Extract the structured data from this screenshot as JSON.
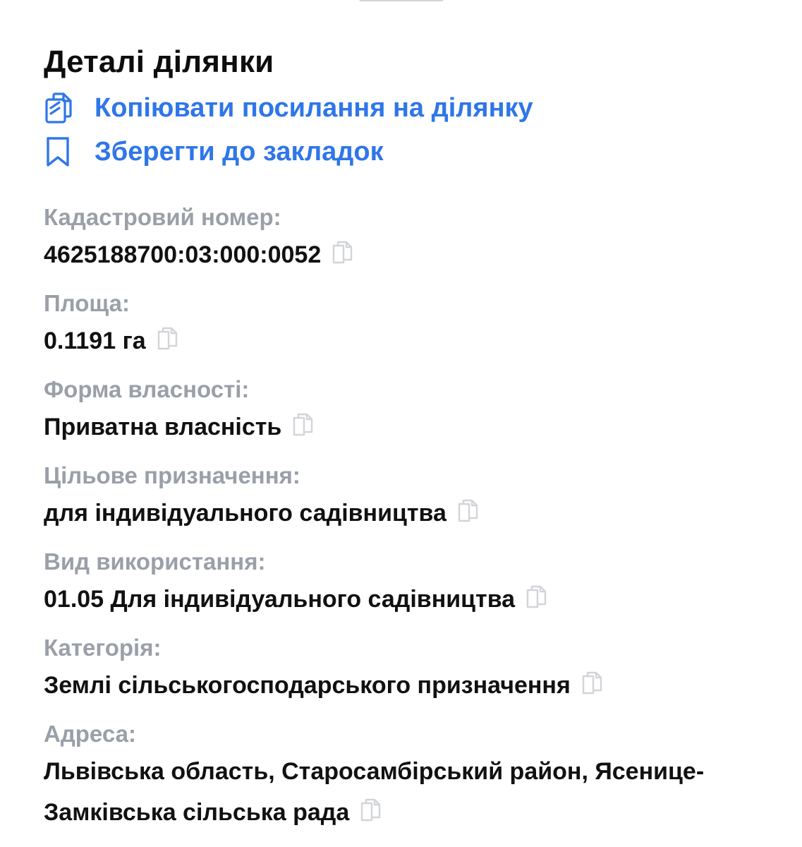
{
  "title": "Деталі ділянки",
  "actions": {
    "copy_link": {
      "label": "Копіювати посилання на ділянку",
      "icon": "clipboard-copy-icon"
    },
    "bookmark": {
      "label": "Зберегти до закладок",
      "icon": "bookmark-icon"
    }
  },
  "fields": [
    {
      "label": "Кадастровий номер:",
      "value": "4625188700:03:000:0052"
    },
    {
      "label": "Площа:",
      "value": "0.1191 га"
    },
    {
      "label": "Форма власності:",
      "value": "Приватна власність"
    },
    {
      "label": "Цільове призначення:",
      "value": "для індивідуального садівництва"
    },
    {
      "label": "Вид використання:",
      "value": "01.05 Для індивідуального садівництва"
    },
    {
      "label": "Категорія:",
      "value": "Землі сільськогосподарського призначення"
    },
    {
      "label": "Адреса:",
      "value": "Львівська область, Старосамбірський район, Ясенице-Замківська сільська рада"
    }
  ],
  "colors": {
    "accent": "#2f76e8",
    "label": "#9a9fa8",
    "text": "#111111",
    "copy_icon": "#d2d4d8"
  }
}
